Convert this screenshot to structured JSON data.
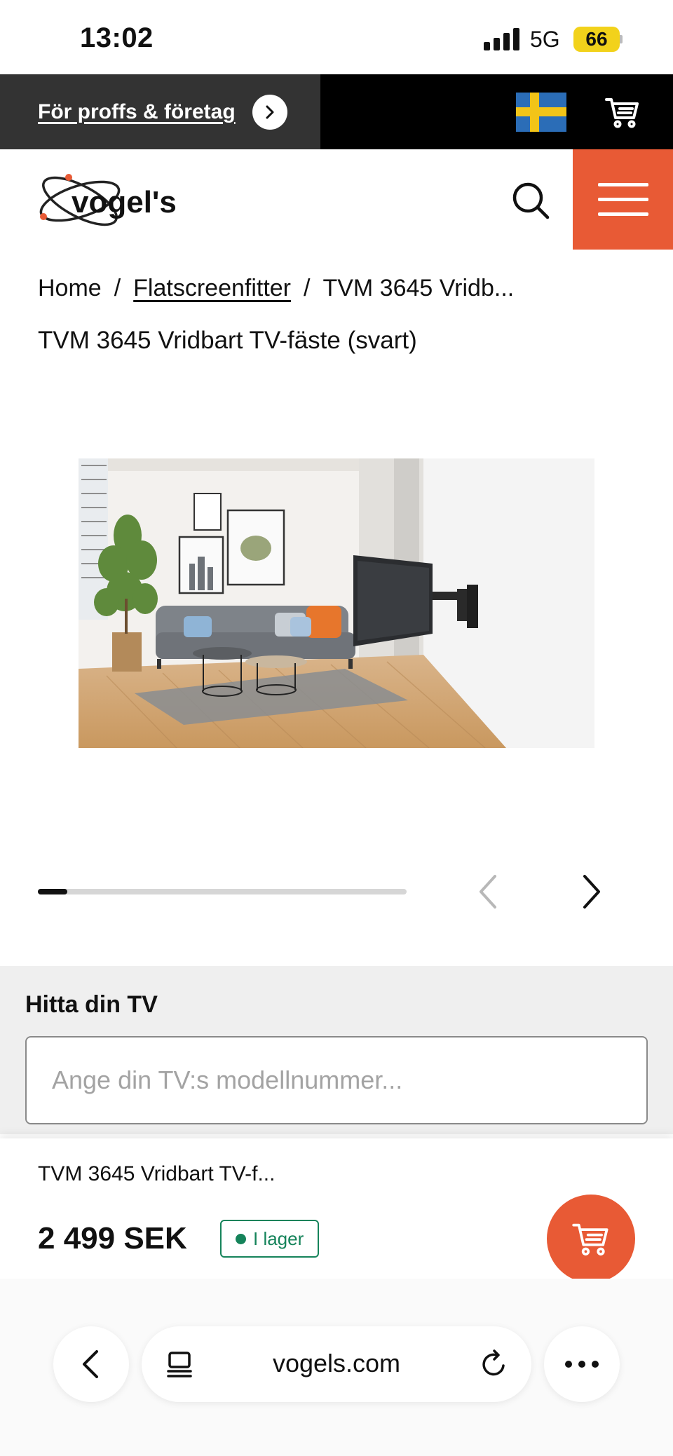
{
  "status_bar": {
    "time": "13:02",
    "network": "5G",
    "battery": "66"
  },
  "pro_bar": {
    "link_label": "För proffs & företag",
    "flag": "sweden-flag-icon",
    "cart_icon": "cart-icon"
  },
  "header": {
    "logo_text": "vogel's",
    "search_icon": "search-icon",
    "menu_icon": "hamburger-menu-icon",
    "accent_color": "#e85a35"
  },
  "breadcrumb": {
    "home": "Home",
    "separator": "/",
    "category": "Flatscreenfitter",
    "current": "TVM 3645 Vridb..."
  },
  "product": {
    "title": "TVM 3645 Vridbart TV-fäste (svart)",
    "image_alt": "TV mounted on swivel wall bracket in living room",
    "gallery_progress_fraction": 0.08
  },
  "find_tv": {
    "title": "Hitta din TV",
    "placeholder": "Ange din TV:s modellnummer..."
  },
  "sticky_bar": {
    "product_name": "TVM 3645 Vridbart TV-f...",
    "price": "2 499 SEK",
    "stock_label": "I lager",
    "stock_color": "#15835a"
  },
  "browser": {
    "url": "vogels.com"
  }
}
